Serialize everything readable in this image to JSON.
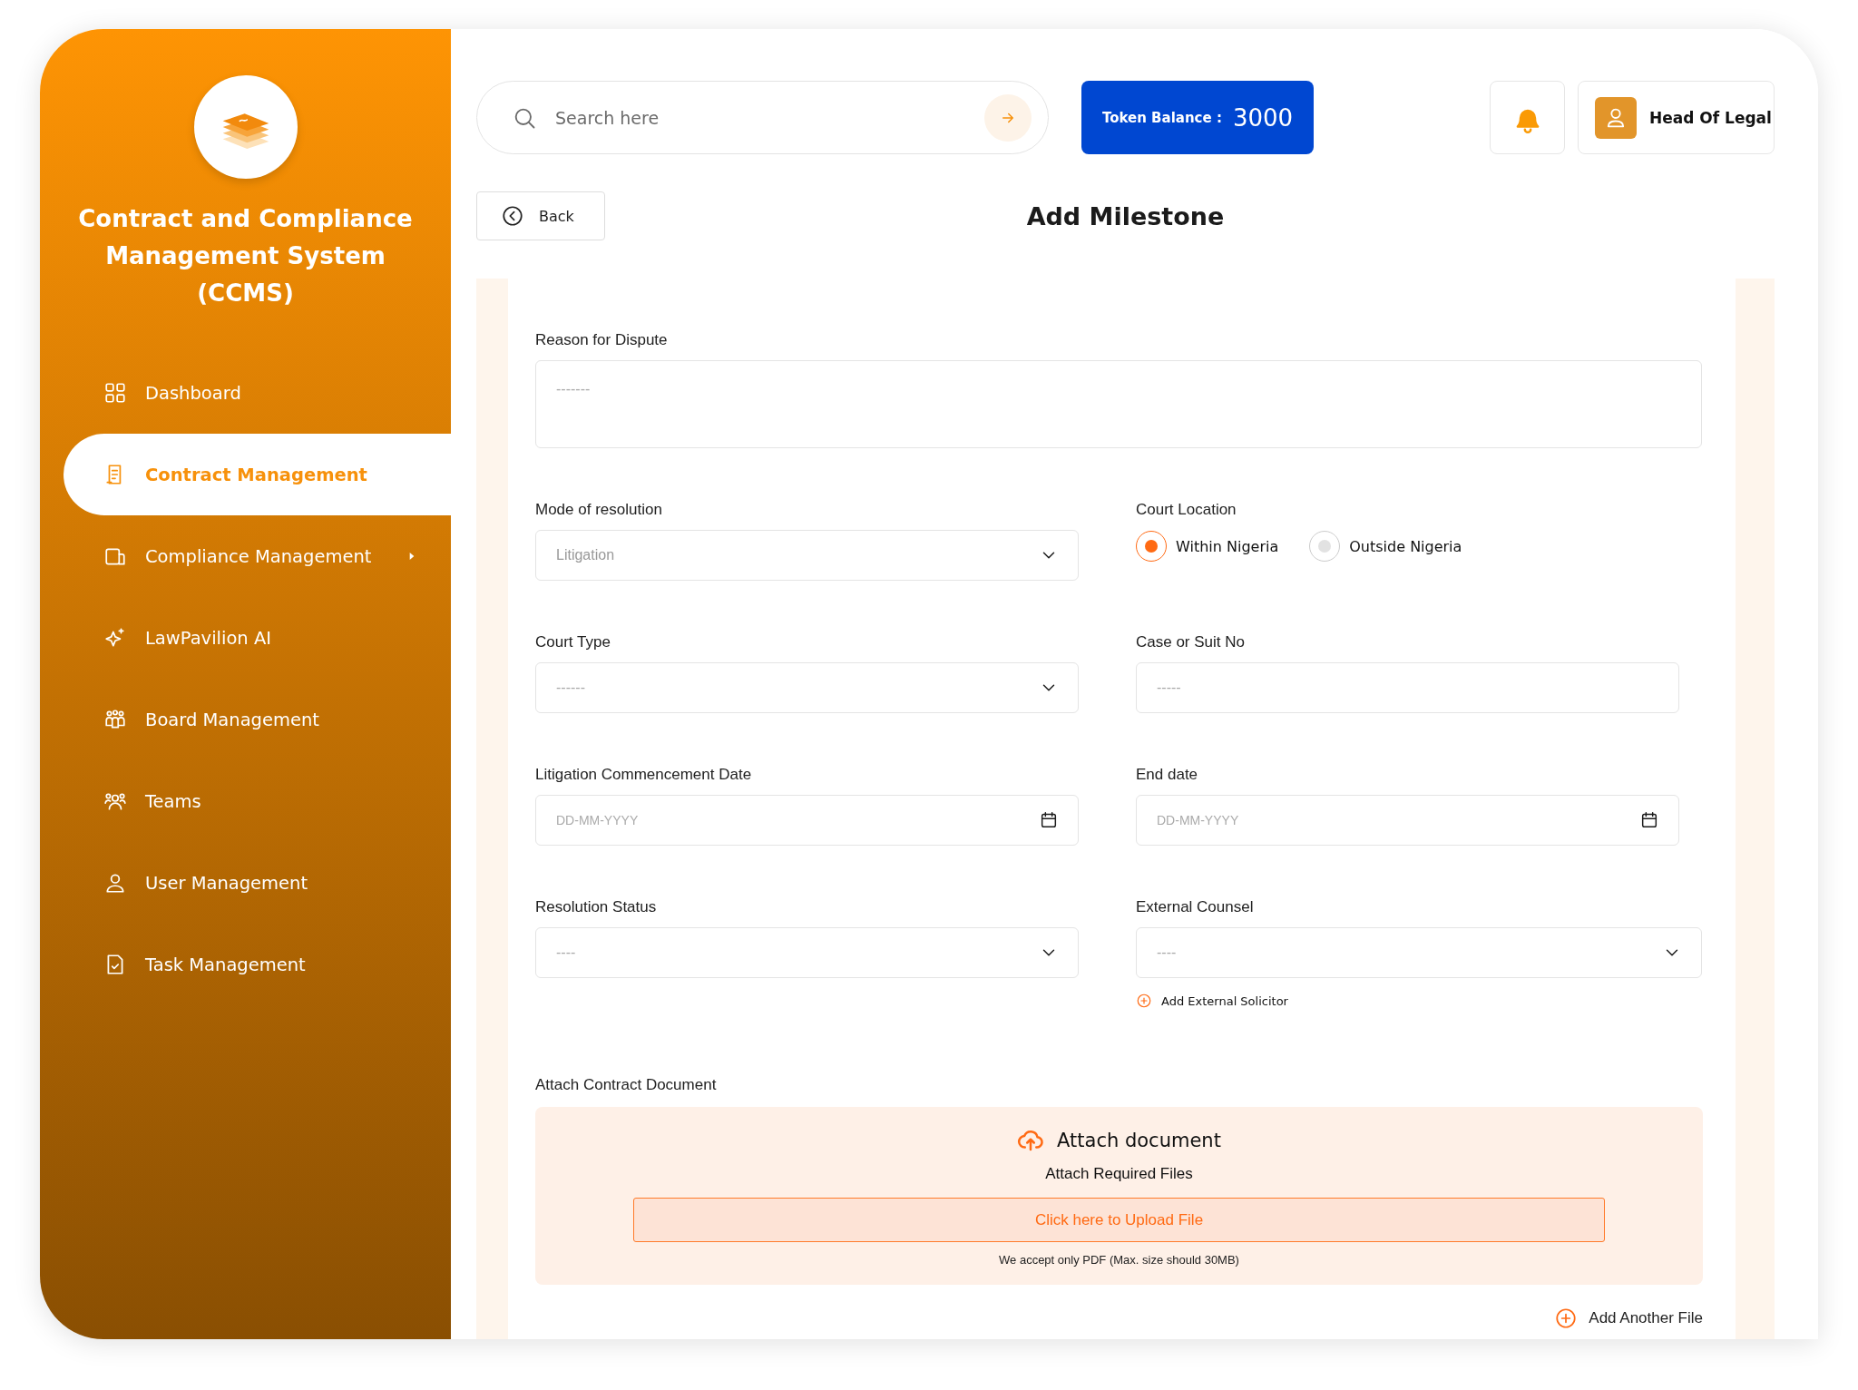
{
  "sidebar": {
    "title": "Contract and Compliance Management System (CCMS)",
    "items": [
      {
        "label": "Dashboard",
        "selected": false,
        "expandable": false
      },
      {
        "label": "Contract Management",
        "selected": true,
        "expandable": false
      },
      {
        "label": "Compliance Management",
        "selected": false,
        "expandable": true
      },
      {
        "label": "LawPavilion AI",
        "selected": false,
        "expandable": false
      },
      {
        "label": "Board Management",
        "selected": false,
        "expandable": false
      },
      {
        "label": "Teams",
        "selected": false,
        "expandable": false
      },
      {
        "label": "User Management",
        "selected": false,
        "expandable": false
      },
      {
        "label": "Task Management",
        "selected": false,
        "expandable": false
      }
    ]
  },
  "topbar": {
    "search": {
      "placeholder": "Search here"
    },
    "token": {
      "label": "Token Balance :",
      "value": "3000"
    },
    "user": {
      "name": "Head Of Legal"
    }
  },
  "page": {
    "back": "Back",
    "title": "Add Milestone"
  },
  "form": {
    "fields": [
      {
        "kind": "textarea",
        "label": "Reason for Dispute",
        "placeholder": "-------"
      },
      {
        "kind": "select",
        "label": "Mode of resolution",
        "value": "Litigation"
      },
      {
        "kind": "radio",
        "label": "Court Location",
        "options": [
          {
            "label": "Within Nigeria",
            "selected": true
          },
          {
            "label": "Outside Nigeria",
            "selected": false
          }
        ]
      },
      {
        "kind": "select",
        "label": "Court Type",
        "placeholder": "------"
      },
      {
        "kind": "text",
        "label": "Case or Suit No",
        "placeholder": "-----"
      },
      {
        "kind": "date",
        "label": "Litigation Commencement Date",
        "placeholder": "DD-MM-YYYY"
      },
      {
        "kind": "date",
        "label": "End date",
        "placeholder": "DD-MM-YYYY"
      },
      {
        "kind": "select",
        "label": "Resolution Status",
        "placeholder": "----"
      },
      {
        "kind": "select",
        "label": "External Counsel",
        "placeholder": "----",
        "link": "Add External Solicitor"
      }
    ],
    "attach": {
      "label": "Attach Contract Document",
      "title": "Attach document",
      "subtitle": "Attach Required Files",
      "button": "Click here to Upload File",
      "note": "We accept only PDF (Max. size should 30MB)",
      "add_more": "Add Another File"
    }
  }
}
